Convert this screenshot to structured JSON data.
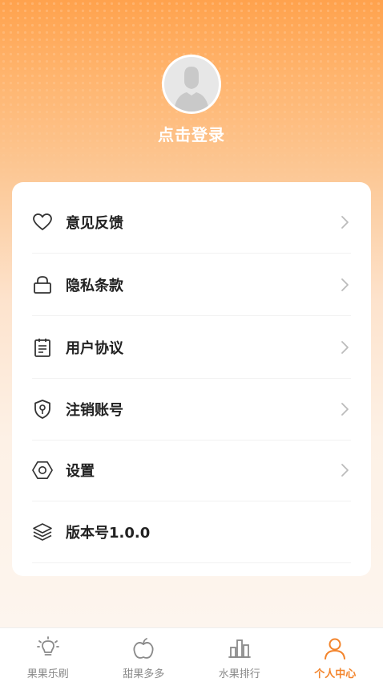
{
  "profile": {
    "login_text": "点击登录",
    "avatar_icon": "default-avatar"
  },
  "menu": {
    "items": [
      {
        "label": "意见反馈",
        "icon": "heart-icon",
        "has_arrow": true
      },
      {
        "label": "隐私条款",
        "icon": "lock-icon",
        "has_arrow": true
      },
      {
        "label": "用户协议",
        "icon": "clipboard-icon",
        "has_arrow": true
      },
      {
        "label": "注销账号",
        "icon": "shield-key-icon",
        "has_arrow": true
      },
      {
        "label": "设置",
        "icon": "hexagon-nut-icon",
        "has_arrow": true
      },
      {
        "label": "版本号1.0.0",
        "icon": "layers-icon",
        "has_arrow": false
      }
    ]
  },
  "tabbar": {
    "tabs": [
      {
        "label": "果果乐刷",
        "icon": "lightbulb-icon",
        "active": false
      },
      {
        "label": "甜果多多",
        "icon": "apple-icon",
        "active": false
      },
      {
        "label": "水果排行",
        "icon": "bar-chart-icon",
        "active": false
      },
      {
        "label": "个人中心",
        "icon": "person-icon",
        "active": true
      }
    ]
  },
  "colors": {
    "accent": "#f3842b",
    "header_top": "#ffa24d",
    "inactive_tab": "#8a8a8a"
  }
}
